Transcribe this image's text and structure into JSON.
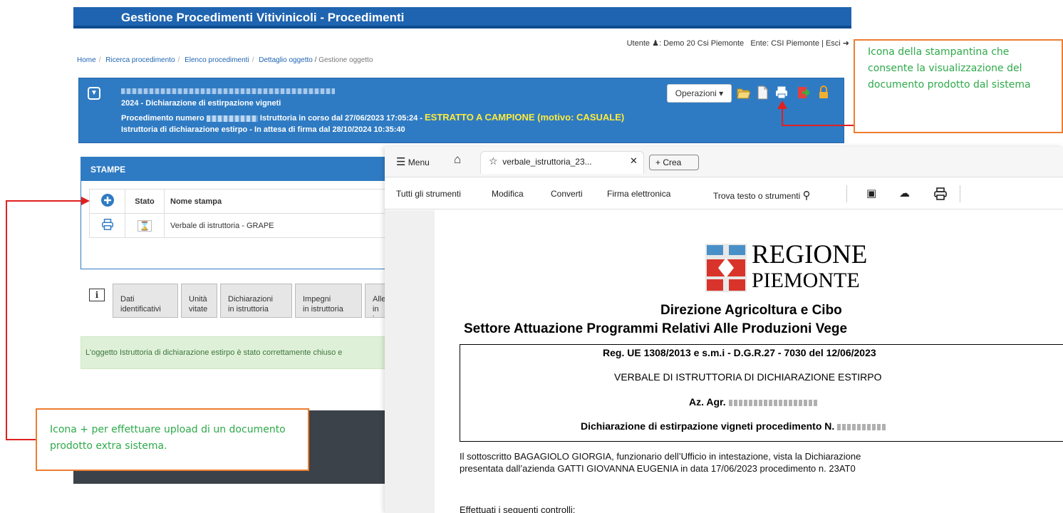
{
  "app": {
    "title": "Gestione Procedimenti Vitivinicoli - Procedimenti"
  },
  "user_bar": {
    "user_label": "Utente",
    "user_name": ": Demo 20 Csi Piemonte",
    "ente": "Ente: CSI Piemonte",
    "sep": "|",
    "logout": "Esci"
  },
  "breadcrumb": [
    "Home",
    "Ricerca procedimento",
    "Elenco procedimenti",
    "Dettaglio oggetto",
    "Gestione oggetto"
  ],
  "banner": {
    "line1": "2024 - Dichiarazione di estirpazione vigneti",
    "line2_prefix": "Procedimento numero",
    "line2_middle": "Istruttoria in corso dal 27/06/2023 17:05:24 -",
    "line2_highlight": "ESTRATTO A CAMPIONE (motivo: CASUALE)",
    "line3": "Istruttoria di dichiarazione estirpo - In attesa di firma dal 28/10/2024 10:35:40",
    "operations_button": "Operazioni"
  },
  "stampe": {
    "title": "STAMPE",
    "headers": [
      "Stato",
      "Nome stampa"
    ],
    "rows": [
      {
        "name": "Verbale di istruttoria - GRAPE",
        "status": "hourglass-icon"
      }
    ]
  },
  "tabs": [
    "Dati\nidentificativi",
    "Unità\nvitate",
    "Dichiarazioni\nin istruttoria",
    "Impegni\nin istruttoria",
    "Alle\nin i"
  ],
  "success_message": "L'oggetto Istruttoria di dichiarazione estirpo è stato correttamente chiuso e",
  "callouts": {
    "print": "Icona della stampantina che consente la visualizzazione del documento prodotto dal sistema",
    "upload": "Icona + per effettuare upload di un documento prodotto extra sistema."
  },
  "viewer": {
    "menu": "Menu",
    "doc_tab": "verbale_istruttoria_23...",
    "create": "Crea",
    "toolbar": [
      "Tutti gli strumenti",
      "Modifica",
      "Converti",
      "Firma elettronica"
    ],
    "search": "Trova testo o strumenti"
  },
  "document": {
    "logo_line1": "REGIONE",
    "logo_line2": "PIEMONTE",
    "direction": "Direzione Agricoltura e Cibo",
    "sector": "Settore Attuazione Programmi Relativi Alle Produzioni Vege",
    "reg": "Reg. UE 1308/2013 e s.m.i - D.G.R.27 - 7030 del 12/06/2023",
    "verbale": "VERBALE  DI ISTRUTTORIA DI DICHIARAZIONE ESTIRPO",
    "azienda_prefix": "Az. Agr.",
    "procedimento_prefix": "Dichiarazione di estirpazione vigneti procedimento N.",
    "body_line1": "Il sottoscritto BAGAGIOLO GIORGIA, funzionario dell’Ufficio in intestazione, vista la Dichiarazione",
    "body_line2": "presentata dall’azienda GATTI GIOVANNA EUGENIA in data 17/06/2023 procedimento n. 23AT0",
    "controls": "Effettuati i seguenti controlli:"
  },
  "colors": {
    "header": "#1f64b0",
    "banner": "#2f7bc3",
    "highlight": "#ffeb3b",
    "callout_border": "#ed7d31",
    "callout_text": "#2eaa4a",
    "arrow": "#e02020"
  }
}
